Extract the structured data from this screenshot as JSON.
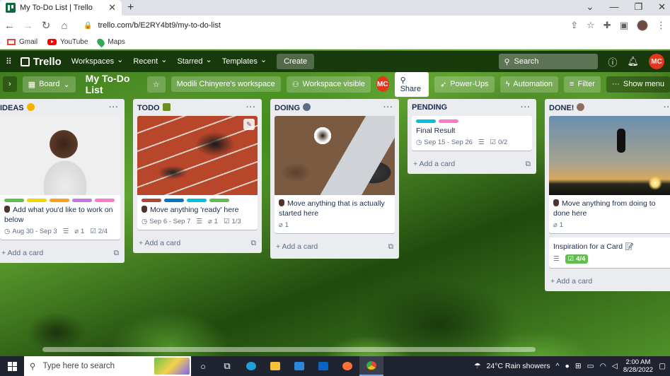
{
  "browser": {
    "tab_title": "My To-Do List | Trello",
    "url": "trello.com/b/E2RY4bt9/my-to-do-list",
    "bookmarks": [
      {
        "label": "Gmail"
      },
      {
        "label": "YouTube"
      },
      {
        "label": "Maps"
      }
    ]
  },
  "header": {
    "logo": "Trello",
    "menus": [
      "Workspaces",
      "Recent",
      "Starred",
      "Templates"
    ],
    "create_label": "Create",
    "search_placeholder": "Search",
    "avatar": "MC"
  },
  "boardbar": {
    "view_label": "Board",
    "title": "My To-Do List",
    "workspace": "Modili Chinyere's workspace",
    "visibility": "Workspace visible",
    "member_avatar": "MC",
    "share_label": "Share",
    "powerups_label": "Power-Ups",
    "automation_label": "Automation",
    "filter_label": "Filter",
    "showmenu_label": "Show menu"
  },
  "lists": [
    {
      "name": "IDEAS",
      "emoji_color": "#f5b301",
      "cards": [
        {
          "labels": [
            "#61bd4f",
            "#f2d600",
            "#ff9f1a",
            "#c377e0",
            "#ff78cb"
          ],
          "text": "Add what you'd like to work on below",
          "date": "Aug 30 - Sep 3",
          "attachments": "1",
          "checklist": "2/4"
        }
      ],
      "add_label": "Add a card"
    },
    {
      "name": "TODO",
      "emoji_color": "#6b8e23",
      "cards": [
        {
          "labels": [
            "#b04632",
            "#0079bf",
            "#00c2e0",
            "#61bd4f"
          ],
          "text": "Move anything 'ready' here",
          "date": "Sep 6 - Sep 7",
          "attachments": "1",
          "checklist": "1/3"
        }
      ],
      "add_label": "Add a card"
    },
    {
      "name": "DOING",
      "emoji_color": "#5e6c84",
      "cards": [
        {
          "text": "Move anything that is actually started here",
          "attachments": "1"
        }
      ],
      "add_label": "Add a card"
    },
    {
      "name": "PENDING",
      "cards": [
        {
          "labels": [
            "#00c2e0",
            "#ff78cb"
          ],
          "text": "Final Result",
          "date": "Sep 15 - Sep 26",
          "checklist": "0/2"
        }
      ],
      "add_label": "Add a card"
    },
    {
      "name": "DONE!",
      "emoji_color": "#8d6e63",
      "cards": [
        {
          "text": "Move anything from doing to done here",
          "attachments": "1"
        },
        {
          "text": "Inspiration for a Card",
          "checklist": "4/4"
        }
      ],
      "add_label": "Add a card"
    }
  ],
  "taskbar": {
    "search_placeholder": "Type here to search",
    "weather": "24°C  Rain showers",
    "time": "2:00 AM",
    "date": "8/28/2022"
  }
}
